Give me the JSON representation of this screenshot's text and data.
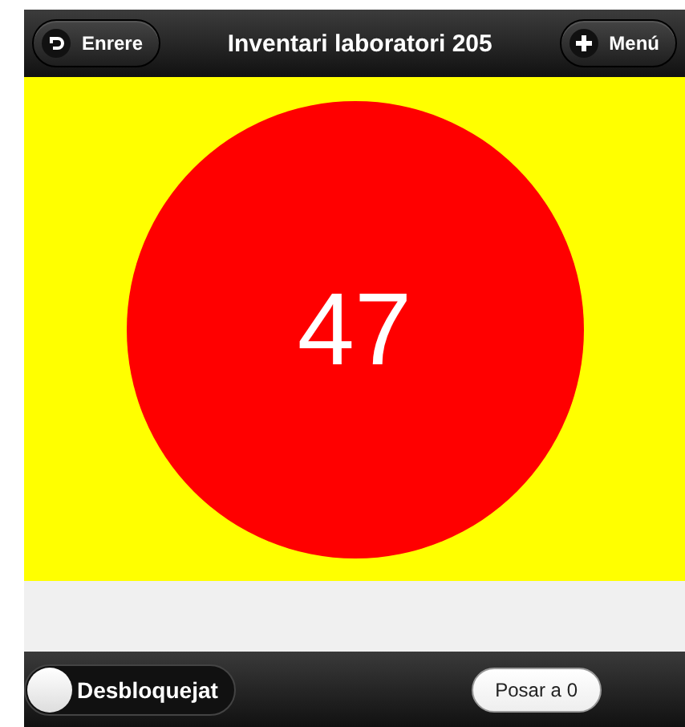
{
  "header": {
    "back_button": "Enrere",
    "title": "Inventari laboratori 205",
    "menu_button": "Menú"
  },
  "counter": {
    "value": "47"
  },
  "footer": {
    "toggle": {
      "label": "Desbloquejat",
      "on": false
    },
    "reset_button": "Posar a 0"
  }
}
